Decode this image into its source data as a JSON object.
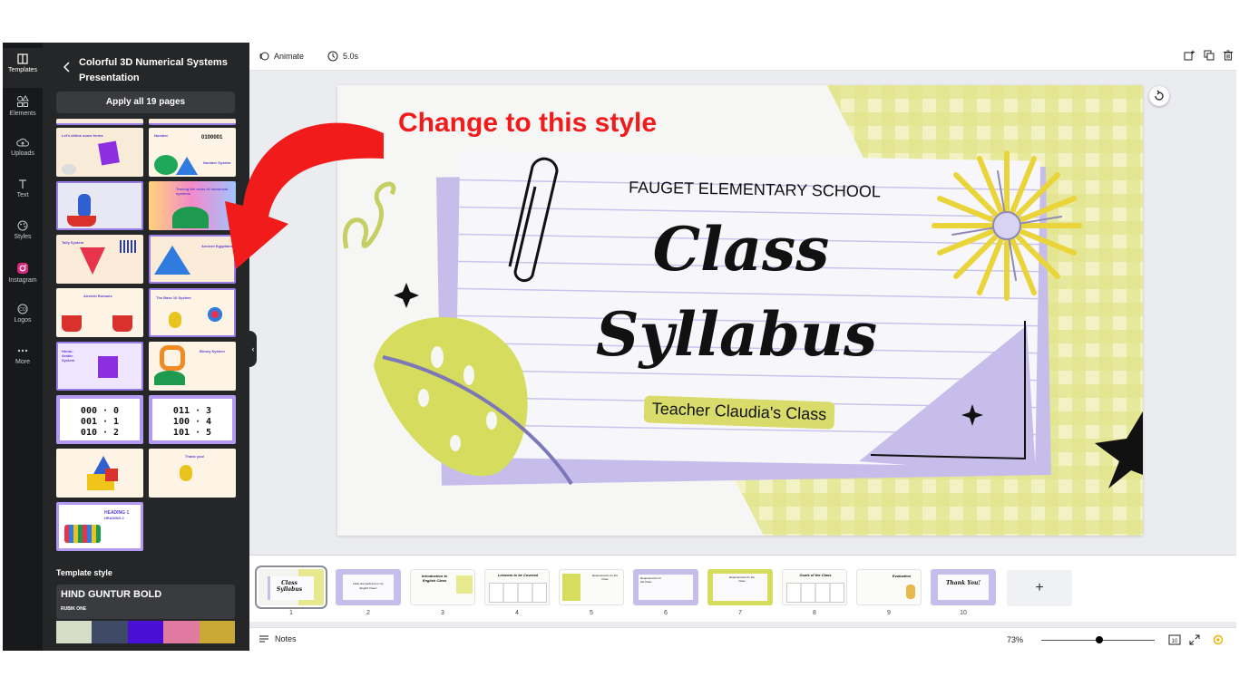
{
  "rail": {
    "items": [
      {
        "label": "Templates",
        "icon": "template-icon"
      },
      {
        "label": "Elements",
        "icon": "elements-icon"
      },
      {
        "label": "Uploads",
        "icon": "upload-cloud-icon"
      },
      {
        "label": "Text",
        "icon": "text-icon"
      },
      {
        "label": "Styles",
        "icon": "palette-icon"
      },
      {
        "label": "Instagram",
        "icon": "instagram-icon"
      },
      {
        "label": "Logos",
        "icon": "logo-icon"
      },
      {
        "label": "More",
        "icon": "more-dots-icon"
      }
    ]
  },
  "panel": {
    "title": "Colorful 3D Numerical Systems Presentation",
    "apply_label": "Apply all 19 pages",
    "thumbs": [
      {
        "text": "Let's define some terms"
      },
      {
        "text": "Number"
      },
      {
        "text": ""
      },
      {
        "text": "Tracing the roots of numerical systems"
      },
      {
        "text": "Tally System"
      },
      {
        "text": "Ancient Egyptians"
      },
      {
        "text": "Ancient Romans"
      },
      {
        "text": "The Base 10 System"
      },
      {
        "text": "Hindu-Arabic System"
      },
      {
        "text": "Binary System"
      },
      {
        "text": "000 · 0\n001 · 1\n010 · 2"
      },
      {
        "text": "011 · 3\n100 · 4\n101 · 5"
      },
      {
        "text": ""
      },
      {
        "text": "Thank you!"
      },
      {
        "text": "HEADING 1"
      }
    ],
    "thumb_number_text": "0100001",
    "thumb_caption_text": "Number System",
    "thumb_heading_2": "HEADING 2",
    "template_style_label": "Template style",
    "font_primary": "HIND GUNTUR BOLD",
    "font_secondary": "RUBIK ONE",
    "palette": [
      "#d6dcc8",
      "#3f4b66",
      "#4a0fd6",
      "#e07aa0",
      "#c9a834"
    ]
  },
  "toolbar": {
    "animate_label": "Animate",
    "duration_label": "5.0s"
  },
  "annotation": {
    "text": "Change to this style",
    "color": "#f21b1b"
  },
  "slide": {
    "school": "FAUGET ELEMENTARY SCHOOL",
    "title_line1": "Class",
    "title_line2": "Syllabus",
    "subtitle": "Teacher Claudia's Class"
  },
  "filmstrip": {
    "pages": [
      {
        "num": "1",
        "text": "Class Syllabus"
      },
      {
        "num": "2",
        "text": "Hello and welcome to my English Class!"
      },
      {
        "num": "3",
        "text": "Introduction to English Class"
      },
      {
        "num": "4",
        "text": "Lessons to be Covered"
      },
      {
        "num": "5",
        "text": "Requirements for the Class"
      },
      {
        "num": "6",
        "text": "Requirements for the Class"
      },
      {
        "num": "7",
        "text": "Requirements for the Class"
      },
      {
        "num": "8",
        "text": "Goals of the Class"
      },
      {
        "num": "9",
        "text": "Evaluation"
      },
      {
        "num": "10",
        "text": "Thank You!"
      }
    ],
    "add_label": "+"
  },
  "bottombar": {
    "notes_label": "Notes",
    "zoom_label": "73%",
    "zoom_value": 0.51
  }
}
